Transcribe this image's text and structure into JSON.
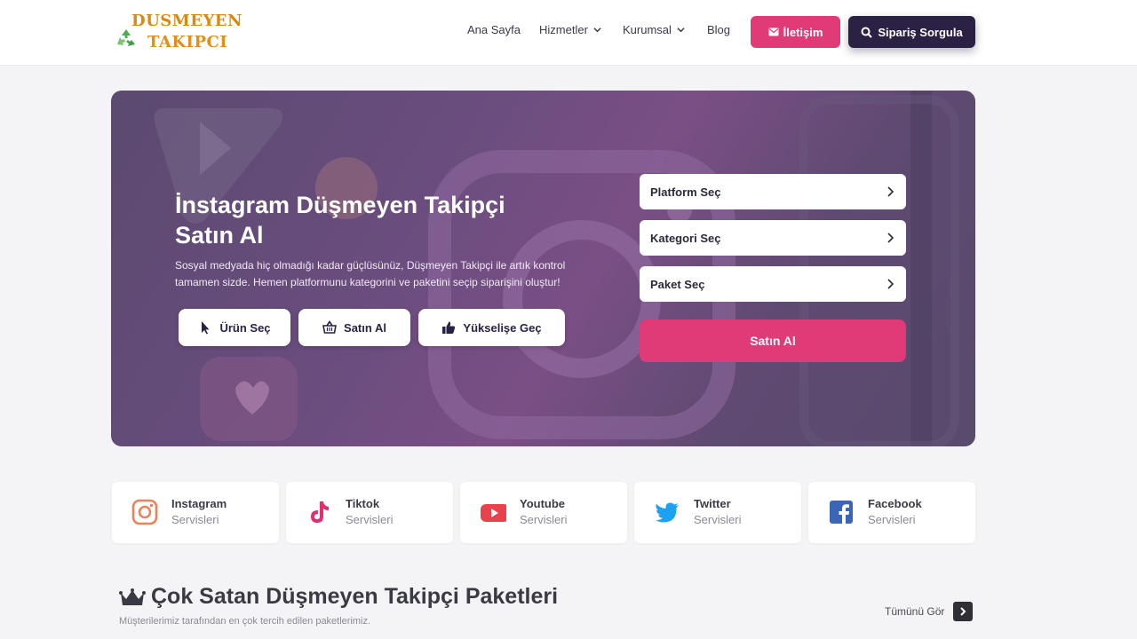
{
  "header": {
    "logo_line1": "DUSMEYEN",
    "logo_line2": "TAKIPCI",
    "nav": [
      {
        "label": "Ana Sayfa"
      },
      {
        "label": "Hizmetler"
      },
      {
        "label": "Kurumsal"
      },
      {
        "label": "Blog"
      }
    ],
    "contact_label": "İletişim",
    "order_label": "Sipariş Sorgula"
  },
  "hero": {
    "title_line1": "İnstagram Düşmeyen Takipçi",
    "title_line2": "Satın Al",
    "description": "Sosyal medyada hiç olmadığı kadar güçlüsünüz, Düşmeyen Takipçi ile artık kontrol tamamen sizde. Hemen platformunu kategorini ve paketini seçip siparişini oluştur!",
    "buttons": [
      {
        "label": "Ürün Seç",
        "icon": "cursor-icon"
      },
      {
        "label": "Satın Al",
        "icon": "basket-icon"
      },
      {
        "label": "Yükselişe Geç",
        "icon": "thumbs-up-icon"
      }
    ],
    "selects": [
      {
        "label": "Platform Seç"
      },
      {
        "label": "Kategori Seç"
      },
      {
        "label": "Paket Seç"
      }
    ],
    "buy_label": "Satın Al"
  },
  "services": [
    {
      "title": "Instagram",
      "subtitle": "Servisleri",
      "icon": "instagram-icon",
      "color": "#e8845a"
    },
    {
      "title": "Tiktok",
      "subtitle": "Servisleri",
      "icon": "tiktok-icon",
      "color": "#e0306f"
    },
    {
      "title": "Youtube",
      "subtitle": "Servisleri",
      "icon": "youtube-icon",
      "color": "#e8434c"
    },
    {
      "title": "Twitter",
      "subtitle": "Servisleri",
      "icon": "twitter-icon",
      "color": "#1da1f2"
    },
    {
      "title": "Facebook",
      "subtitle": "Servisleri",
      "icon": "facebook-icon",
      "color": "#3b66b5"
    }
  ],
  "bestsellers": {
    "title": "Çok Satan Düşmeyen Takipçi Paketleri",
    "subtitle": "Müşterilerimiz tarafından en çok tercih edilen paketlerimiz.",
    "see_all": "Tümünü Gör"
  },
  "colors": {
    "accent": "#e03a77",
    "dark": "#2a2145",
    "logo": "#d98a12"
  }
}
